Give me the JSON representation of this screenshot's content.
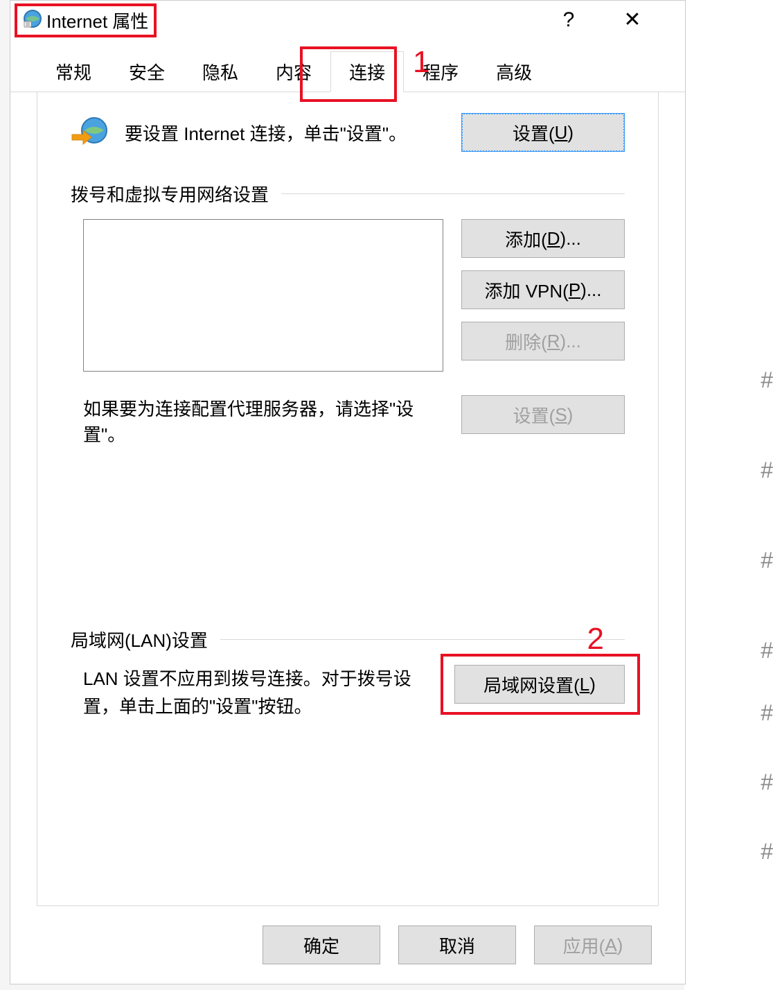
{
  "window": {
    "title": "Internet 属性",
    "help_symbol": "?",
    "close_symbol": "✕"
  },
  "tabs": {
    "items": [
      {
        "label": "常规"
      },
      {
        "label": "安全"
      },
      {
        "label": "隐私"
      },
      {
        "label": "内容"
      },
      {
        "label": "连接",
        "active": true
      },
      {
        "label": "程序"
      },
      {
        "label": "高级"
      }
    ]
  },
  "annotations": {
    "num1": "1",
    "num2": "2"
  },
  "setup": {
    "text": "要设置 Internet 连接，单击\"设置\"。",
    "button_prefix": "设置(",
    "button_ul": "U",
    "button_suffix": ")"
  },
  "dial": {
    "section_title": "拨号和虚拟专用网络设置",
    "add_prefix": "添加(",
    "add_ul": "D",
    "add_suffix": ")...",
    "addvpn_prefix": "添加 VPN(",
    "addvpn_ul": "P",
    "addvpn_suffix": ")...",
    "remove_prefix": "删除(",
    "remove_ul": "R",
    "remove_suffix": ")...",
    "proxy_text": "如果要为连接配置代理服务器，请选择\"设置\"。",
    "settings_prefix": "设置(",
    "settings_ul": "S",
    "settings_suffix": ")"
  },
  "lan": {
    "section_title": "局域网(LAN)设置",
    "text": "LAN 设置不应用到拨号连接。对于拨号设置，单击上面的\"设置\"按钮。",
    "button_prefix": "局域网设置(",
    "button_ul": "L",
    "button_suffix": ")"
  },
  "footer": {
    "ok": "确定",
    "cancel": "取消",
    "apply_prefix": "应用(",
    "apply_ul": "A",
    "apply_suffix": ")"
  }
}
